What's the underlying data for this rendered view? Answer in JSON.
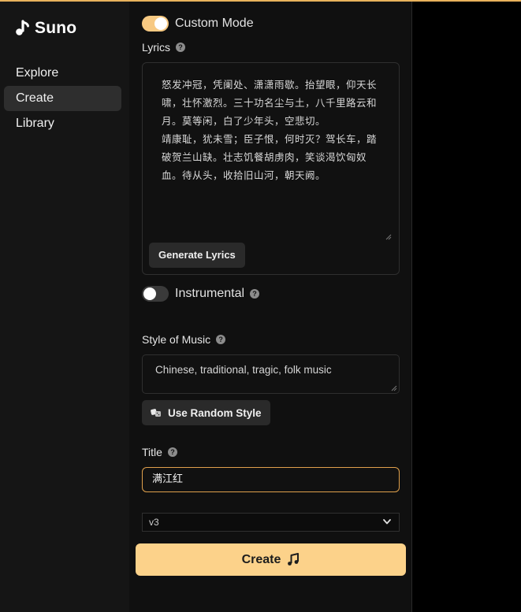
{
  "brand": {
    "name": "Suno"
  },
  "sidebar": {
    "items": [
      {
        "label": "Explore",
        "active": false
      },
      {
        "label": "Create",
        "active": true
      },
      {
        "label": "Library",
        "active": false
      }
    ]
  },
  "form": {
    "custom_mode": {
      "label": "Custom Mode",
      "on": true
    },
    "lyrics": {
      "label": "Lyrics",
      "value": "怒发冲冠，凭阑处、潇潇雨歇。抬望眼，仰天长啸，壮怀激烈。三十功名尘与土，八千里路云和月。莫等闲，白了少年头，空悲切。\n靖康耻，犹未雪；臣子恨，何时灭？驾长车，踏破贺兰山缺。壮志饥餐胡虏肉，笑谈渴饮匈奴血。待从头，收拾旧山河，朝天阙。",
      "generate_button": "Generate Lyrics"
    },
    "instrumental": {
      "label": "Instrumental",
      "on": false
    },
    "style": {
      "label": "Style of Music",
      "value": "Chinese, traditional, tragic, folk music",
      "random_button": "Use Random Style"
    },
    "title": {
      "label": "Title",
      "value": "满江红"
    },
    "version": {
      "selected": "v3"
    },
    "create_button": "Create"
  },
  "colors": {
    "accent": "#fcd28a",
    "toggle_on": "#f7c982",
    "focus_border": "#e0a04c"
  },
  "icons": [
    "suno-logo-icon",
    "help-icon",
    "dice-icon",
    "chevron-down-icon",
    "music-note-icon"
  ]
}
